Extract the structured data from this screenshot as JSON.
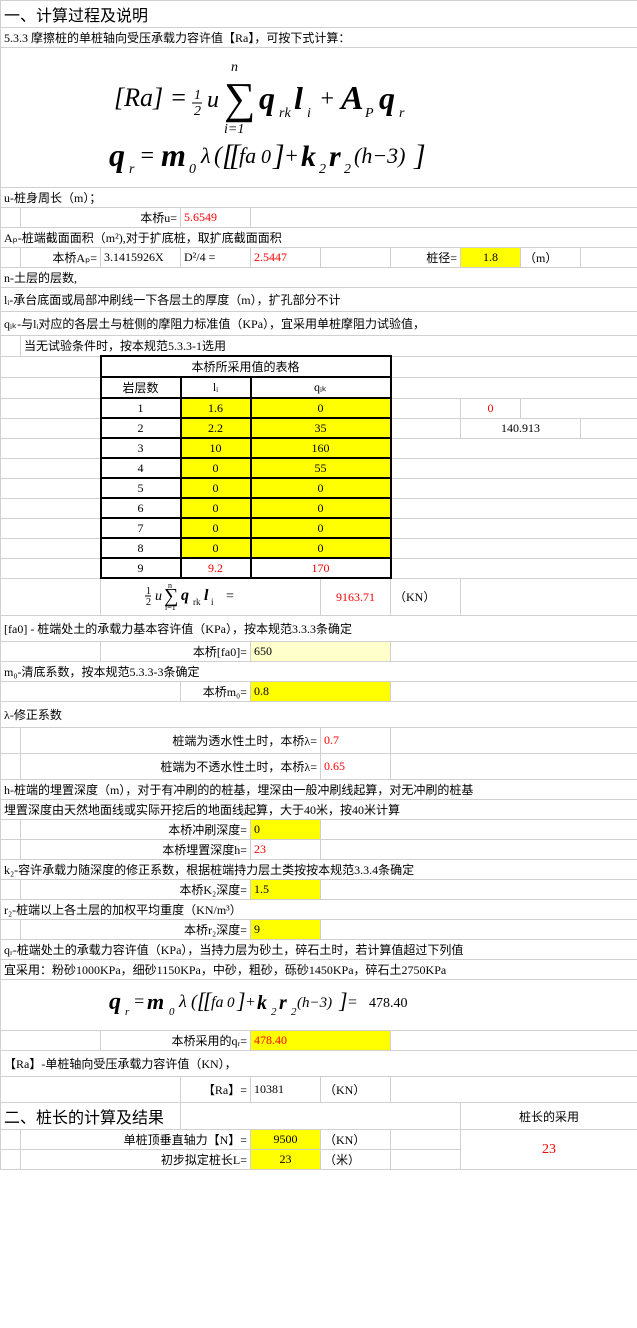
{
  "section1_title": "一、计算过程及说明",
  "rule_5_3_3": "5.3.3 摩擦桩的单桩轴向受压承载力容许值【Ra】，可按下式计算：",
  "u_def": "u-桩身周长（m）；",
  "u_label": "本桥u=",
  "u_val": "5.6549",
  "ap_def": "Aₚ-桩端截面面积（m²),对于扩底桩，取扩底截面面积",
  "ap_label": "本桥Aₚ=",
  "ap_formula": "3.1415926X",
  "ap_formula2": "D²/4  =",
  "ap_val": "2.5447",
  "diameter_label": "桩径=",
  "diameter_val": "1.8",
  "diameter_unit": "（m）",
  "n_def": "n-土层的层数,",
  "li_def": "lᵢ-承台底面或局部冲刷线一下各层土的厚度（m），扩孔部分不计",
  "qik_def": "qᵢₖ-与lᵢ对应的各层土与桩侧的摩阻力标准值（KPa），宜采用单桩摩阻力试验值，",
  "qik_note": "当无试验条件时，按本规范5.3.3-1选用",
  "table_title": "本桥所采用值的表格",
  "col1": "岩层数",
  "col2": "lᵢ",
  "col3": "qᵢₖ",
  "rows": [
    {
      "n": "1",
      "l": "1.6",
      "q": "0"
    },
    {
      "n": "2",
      "l": "2.2",
      "q": "35"
    },
    {
      "n": "3",
      "l": "10",
      "q": "160"
    },
    {
      "n": "4",
      "l": "0",
      "q": "55"
    },
    {
      "n": "5",
      "l": "0",
      "q": "0"
    },
    {
      "n": "6",
      "l": "0",
      "q": "0"
    },
    {
      "n": "7",
      "l": "0",
      "q": "0"
    },
    {
      "n": "8",
      "l": "0",
      "q": "0"
    },
    {
      "n": "9",
      "l": "9.2",
      "q": "170"
    }
  ],
  "side_val1": "0",
  "side_val2": "140.913",
  "sum_eq": " =",
  "sum_val": "9163.71",
  "sum_unit": "（KN）",
  "fa0_def": "[fa0] - 桩端处土的承载力基本容许值（KPa），按本规范3.3.3条确定",
  "fa0_label": "本桥[fa0]=",
  "fa0_val": "650",
  "m0_def": "m₀-清底系数，按本规范5.3.3-3条确定",
  "m0_label": "本桥m₀=",
  "m0_val": "0.8",
  "lambda_def": "λ-修正系数",
  "lambda_perm_label": "桩端为透水性土时，本桥λ=",
  "lambda_perm_val": "0.7",
  "lambda_imperm_label": "桩端为不透水性土时，本桥λ=",
  "lambda_imperm_val": "0.65",
  "h_def1": "h-桩端的埋置深度（m），对于有冲刷的的桩基，埋深由一般冲刷线起算，对无冲刷的桩基",
  "h_def2": "埋置深度由天然地面线或实际开挖后的地面线起算，大于40米，按40米计算",
  "scour_label": "本桥冲刷深度=",
  "scour_val": "0",
  "depth_label": "本桥埋置深度h=",
  "depth_val": "23",
  "k2_def": "k₂-容许承载力随深度的修正系数，根据桩端持力层土类按按本规范3.3.4条确定",
  "k2_label": "本桥K₂深度=",
  "k2_val": "1.5",
  "r2_def": "r₂-桩端以上各土层的加权平均重度（KN/m³）",
  "r2_label": "本桥r₂深度=",
  "r2_val": "9",
  "qr_def1": "qᵣ-桩端处土的承载力容许值（KPa），当持力层为砂土，碎石土时，若计算值超过下列值",
  "qr_def2": "宜采用：粉砂1000KPa，细砂1150KPa，中砂，粗砂，砾砂1450KPa，碎石土2750KPa",
  "qr_calc_val": "478.40",
  "qr_used_label": "本桥采用的qᵣ=",
  "qr_used_val": "478.40",
  "ra_def": "【Ra】-单桩轴向受压承载力容许值（KN），",
  "ra_label": "【Ra】=",
  "ra_val": "10381",
  "ra_unit": "（KN）",
  "section2_title": "二、桩长的计算及结果",
  "pile_len_adopt": "桩长的采用",
  "n_force_label": "单桩顶垂直轴力【N】=",
  "n_force_val": "9500",
  "n_force_unit": "（KN）",
  "final_len_label": "初步拟定桩长L=",
  "final_len_val": "23",
  "final_len_unit": "（米）",
  "adopt_val": "23"
}
